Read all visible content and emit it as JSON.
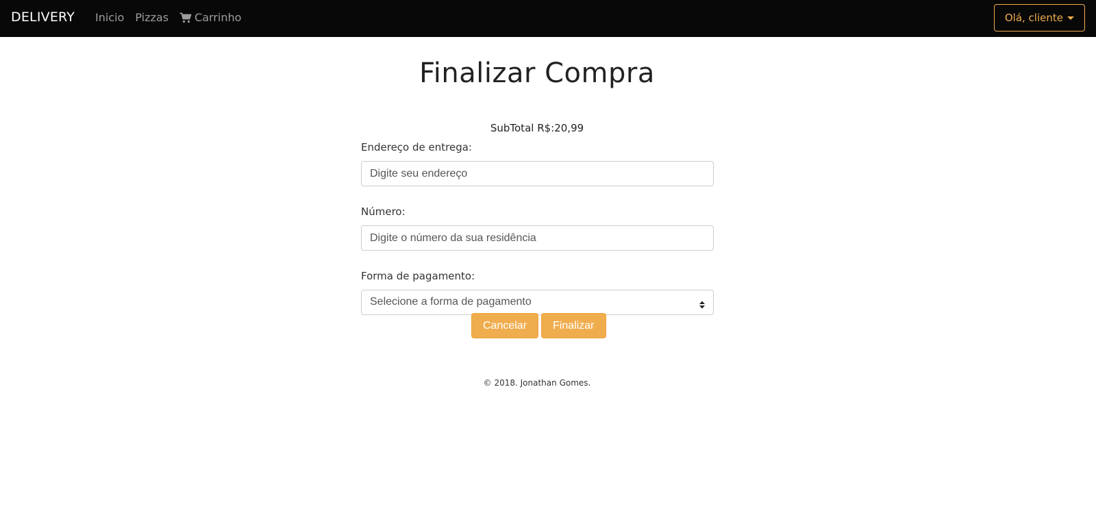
{
  "navbar": {
    "brand": "DELIVERY",
    "links": [
      {
        "label": "Inicio",
        "icon": null
      },
      {
        "label": "Pizzas",
        "icon": null
      },
      {
        "label": "Carrinho",
        "icon": "shopping-cart-icon"
      }
    ],
    "user_menu_label": "Olá, cliente",
    "user_menu_icon": "caret-down-icon"
  },
  "main": {
    "title": "Finalizar Compra",
    "subtotal": "SubTotal R$:20,99",
    "form": {
      "address_label": "Endereço de entrega:",
      "address_placeholder": "Digite seu endereço",
      "number_label": "Número:",
      "number_placeholder": "Digite o número da sua residência",
      "payment_label": "Forma de pagamento:",
      "payment_selected": "Selecione a forma de pagamento"
    },
    "buttons": {
      "cancel": "Cancelar",
      "submit": "Finalizar"
    }
  },
  "footer": {
    "text": "© 2018. Jonathan Gomes."
  },
  "colors": {
    "navbar_bg": "#080808",
    "accent": "#f0ad4e",
    "nav_link": "#9d9d9d"
  }
}
